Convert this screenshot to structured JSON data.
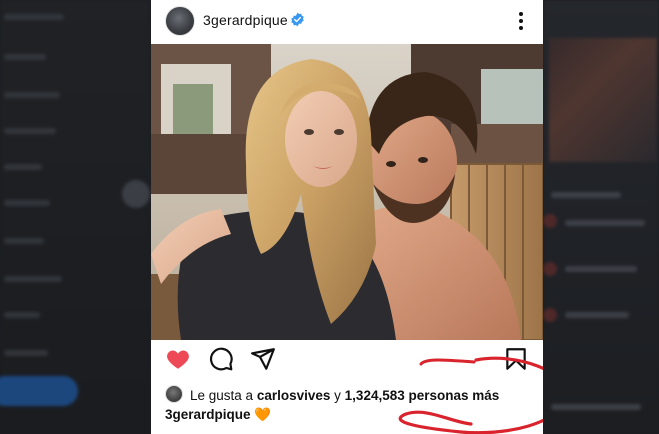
{
  "post": {
    "username": "3gerardpique",
    "photo": {
      "alt": ""
    },
    "likes": {
      "prefix": "Le gusta a",
      "liker": "carlosvives",
      "middle": "y",
      "count": "1,324,583",
      "suffix": "personas más"
    },
    "caption": {
      "username": "3gerardpique",
      "emoji": "🧡"
    }
  },
  "icons": {
    "verified": "verified-badge-icon",
    "more": "more-vertical-icon",
    "like": "heart-filled-icon",
    "comment": "comment-icon",
    "share": "send-icon",
    "save": "bookmark-icon"
  },
  "colors": {
    "like_red": "#ed4956",
    "verified_blue": "#3897f0",
    "annotation_red": "#d9242d"
  }
}
